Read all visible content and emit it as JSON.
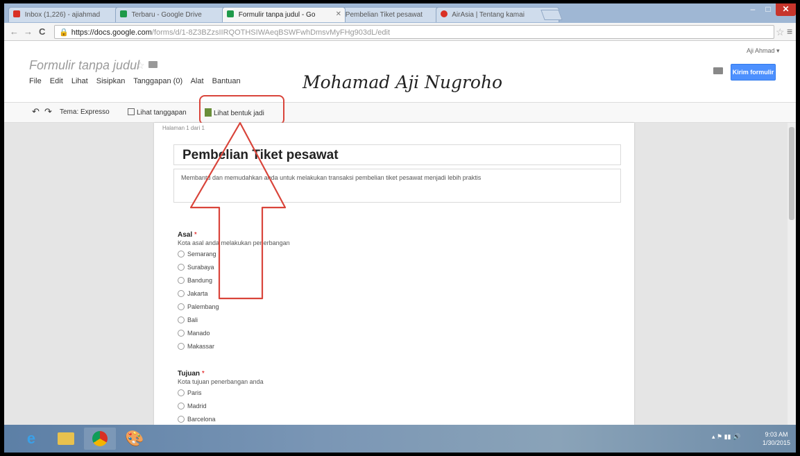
{
  "browser": {
    "tabs": [
      {
        "label": "Inbox (1,226) - ajiahmad",
        "fav_color": "#d93025"
      },
      {
        "label": "Terbaru - Google Drive",
        "fav_color": "#1f9a4a"
      },
      {
        "label": "Formulir tanpa judul - Go",
        "fav_color": "#1f9a4a"
      },
      {
        "label": "Pembelian Tiket pesawat",
        "fav_color": "#e8e8e8"
      },
      {
        "label": "AirAsia | Tentang kamai",
        "fav_color": "#d93025"
      }
    ],
    "active_tab": 2,
    "url_host": "https://docs.google.com",
    "url_path": "/forms/d/1-8Z3BZzsIIRQOTHSIWAeqBSWFwhDmsvMyFHg903dL/edit",
    "win_min": "–",
    "win_max": "□",
    "win_close": "✕"
  },
  "forms_header": {
    "title": "Formulir tanpa judul",
    "menus": [
      "File",
      "Edit",
      "Lihat",
      "Sisipkan",
      "Tanggapan (0)",
      "Alat",
      "Bantuan"
    ],
    "signature": "Mohamad Aji Nugroho",
    "account": "Aji Ahmad ▾",
    "view_button": "Kirim formulir"
  },
  "toolbar": {
    "undo": "↶",
    "redo": "↷",
    "theme": "Tema: Expresso",
    "responses": "Lihat tanggapan",
    "live_form": "Lihat bentuk jadi"
  },
  "form": {
    "page_label": "Halaman 1 dari 1",
    "title": "Pembelian Tiket pesawat",
    "description": "Membantu dan memudahkan anda untuk melakukan transaksi pembelian tiket pesawat menjadi lebih praktis",
    "questions": [
      {
        "title": "Asal",
        "help": "Kota asal anda melakukan penerbangan",
        "options": [
          "Semarang",
          "Surabaya",
          "Bandung",
          "Jakarta",
          "Palembang",
          "Bali",
          "Manado",
          "Makassar"
        ]
      },
      {
        "title": "Tujuan",
        "help": "Kota tujuan penerbangan anda",
        "options": [
          "Paris",
          "Madrid",
          "Barcelona"
        ]
      }
    ]
  },
  "taskbar": {
    "tray": "▴ ⚑ ▮▮ 🔊",
    "time": "9:03 AM",
    "date": "1/30/2015"
  },
  "colors": {
    "annotation": "#d9443a",
    "accent_button": "#4d90fe"
  }
}
